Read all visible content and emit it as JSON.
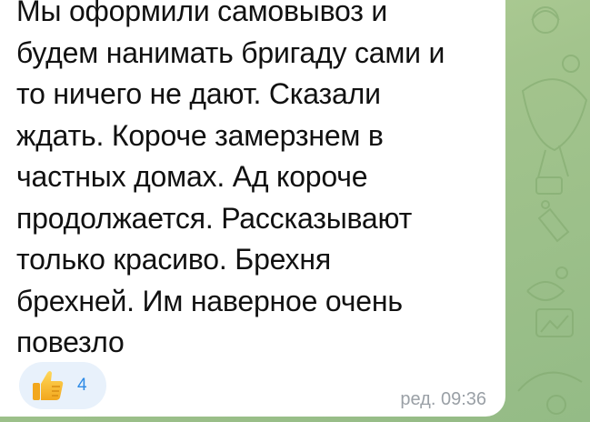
{
  "message": {
    "text": "Мы оформили самовывоз и\nбудем нанимать бригаду сами и\nто ничего не дают. Сказали\nждать. Короче замерзнем в\nчастных домах. Ад короче\nпродолжается. Рассказывают\nтолько красиво. Брехня\nбрехней. Им наверное очень\nповезло",
    "edited_time": "ред. 09:36"
  },
  "reaction": {
    "icon": "thumbs-up-icon",
    "count": "4"
  },
  "colors": {
    "bubble": "#ffffff",
    "reaction_bg": "#e8f1fb",
    "reaction_count": "#2d8ae6",
    "timestamp": "#9aa0a6",
    "chat_background": "#a7c58f"
  }
}
